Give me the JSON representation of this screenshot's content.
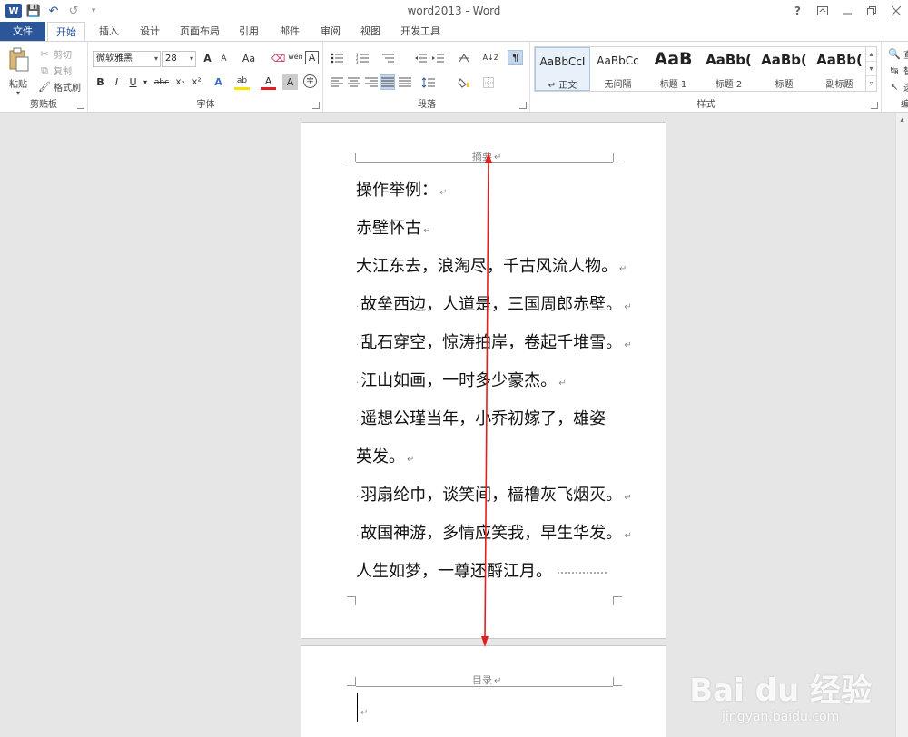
{
  "window": {
    "title": "word2013 - Word",
    "help": "?",
    "controls": [
      "minimize-icon",
      "restore-icon",
      "close-icon"
    ]
  },
  "qat": {
    "app_badge": "W",
    "save": "💾",
    "undo": "↶",
    "redo": "↺",
    "customize": "▾"
  },
  "tabs": [
    "文件",
    "开始",
    "插入",
    "设计",
    "页面布局",
    "引用",
    "邮件",
    "审阅",
    "视图",
    "开发工具"
  ],
  "active_tab": "开始",
  "ribbon": {
    "clipboard": {
      "paste": "粘贴",
      "cut": "剪切",
      "copy": "复制",
      "format_painter": "格式刷",
      "label": "剪贴板"
    },
    "font": {
      "font_name": "微软雅黑",
      "font_size": "28",
      "grow": "A",
      "shrink": "A",
      "case": "Aa",
      "clear": "⌫",
      "phonetic": "wén",
      "border": "A",
      "bold": "B",
      "italic": "I",
      "underline": "U",
      "strike": "abc",
      "sub": "x₂",
      "sup": "x²",
      "effects": "A",
      "highlight": "ab",
      "color": "A",
      "shade": "A",
      "enclose": "字",
      "label": "字体"
    },
    "paragraph": {
      "label": "段落",
      "sort": "A↓Z",
      "show_marks": "¶"
    },
    "styles": {
      "label": "样式",
      "items": [
        {
          "sample": "AaBbCcI",
          "name": "↵ 正文"
        },
        {
          "sample": "AaBbCc",
          "name": "无间隔"
        },
        {
          "sample": "AaB",
          "name": "标题 1"
        },
        {
          "sample": "AaBb(",
          "name": "标题 2"
        },
        {
          "sample": "AaBb(",
          "name": "标题"
        },
        {
          "sample": "AaBb(",
          "name": "副标题"
        }
      ]
    },
    "editing": {
      "find": "查",
      "replace": "替",
      "select": "选",
      "label": "编"
    }
  },
  "document": {
    "page1": {
      "header": "摘要",
      "lines": [
        "操作举例：",
        "赤壁怀古",
        "大江东去，浪淘尽，千古风流人物。",
        "故垒西边，人道是，三国周郎赤壁。",
        "乱石穿空，惊涛拍岸，卷起千堆雪。",
        "江山如画，一时多少豪杰。",
        "遥想公瑾当年，小乔初嫁了，雄姿",
        "英发。",
        "羽扇纶巾，谈笑间，樯橹灰飞烟灭。",
        "故国神游，多情应笑我，早生华发。",
        "人生如梦，一尊还酹江月。"
      ]
    },
    "page2": {
      "header": "目录"
    },
    "paragraph_mark": "↵"
  },
  "annotation": {
    "color": "#e02020"
  },
  "watermark": {
    "logo": "Bai du 经验",
    "url": "jingyan.baidu.com"
  },
  "colors": {
    "accent": "#2b579a",
    "highlight": "#f5e400",
    "font_color": "#e02020"
  }
}
